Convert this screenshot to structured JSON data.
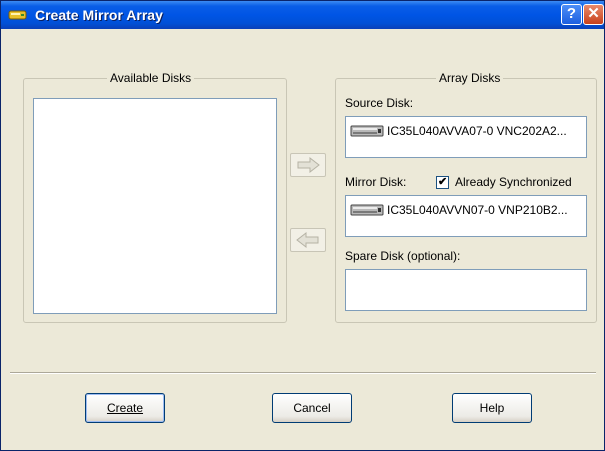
{
  "window": {
    "title": "Create Mirror Array"
  },
  "titlebar": {
    "help_label": "?",
    "close_label": "✕"
  },
  "available": {
    "legend": "Available Disks",
    "items": []
  },
  "array": {
    "legend": "Array Disks",
    "source_label": "Source Disk:",
    "source_disk": "IC35L040AVVA07-0 VNC202A2...",
    "mirror_label": "Mirror Disk:",
    "already_synchronized_label": "Already Synchronized",
    "already_synchronized": true,
    "mirror_disk": "IC35L040AVVN07-0 VNP210B2...",
    "spare_label": "Spare Disk (optional):",
    "spare_disk": ""
  },
  "buttons": {
    "create": "Create",
    "cancel": "Cancel",
    "help": "Help"
  }
}
